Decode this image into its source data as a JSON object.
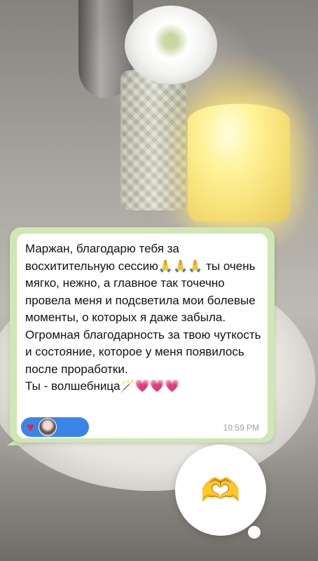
{
  "message": {
    "text": "Маржан, благодарю тебя за восхитительную сессию🙏🙏🙏 ты очень мягко, нежно, а главное так точечно провела меня и подсветила мои болевые моменты, о которых я даже забыла.\nОгромная благодарность за твою чуткость и состояние, которое у меня появилось после проработки.\nТы - волшебница🪄💗💗💗",
    "timestamp": "10:59 PM",
    "reactions": {
      "emoji": "♥",
      "reactor": "avatar"
    }
  },
  "reaction_sticker": {
    "emoji": "🫶"
  },
  "colors": {
    "bubble_frame": "#cfe7b5",
    "reaction_pill": "#3a86e8",
    "heart": "#e3262a"
  }
}
